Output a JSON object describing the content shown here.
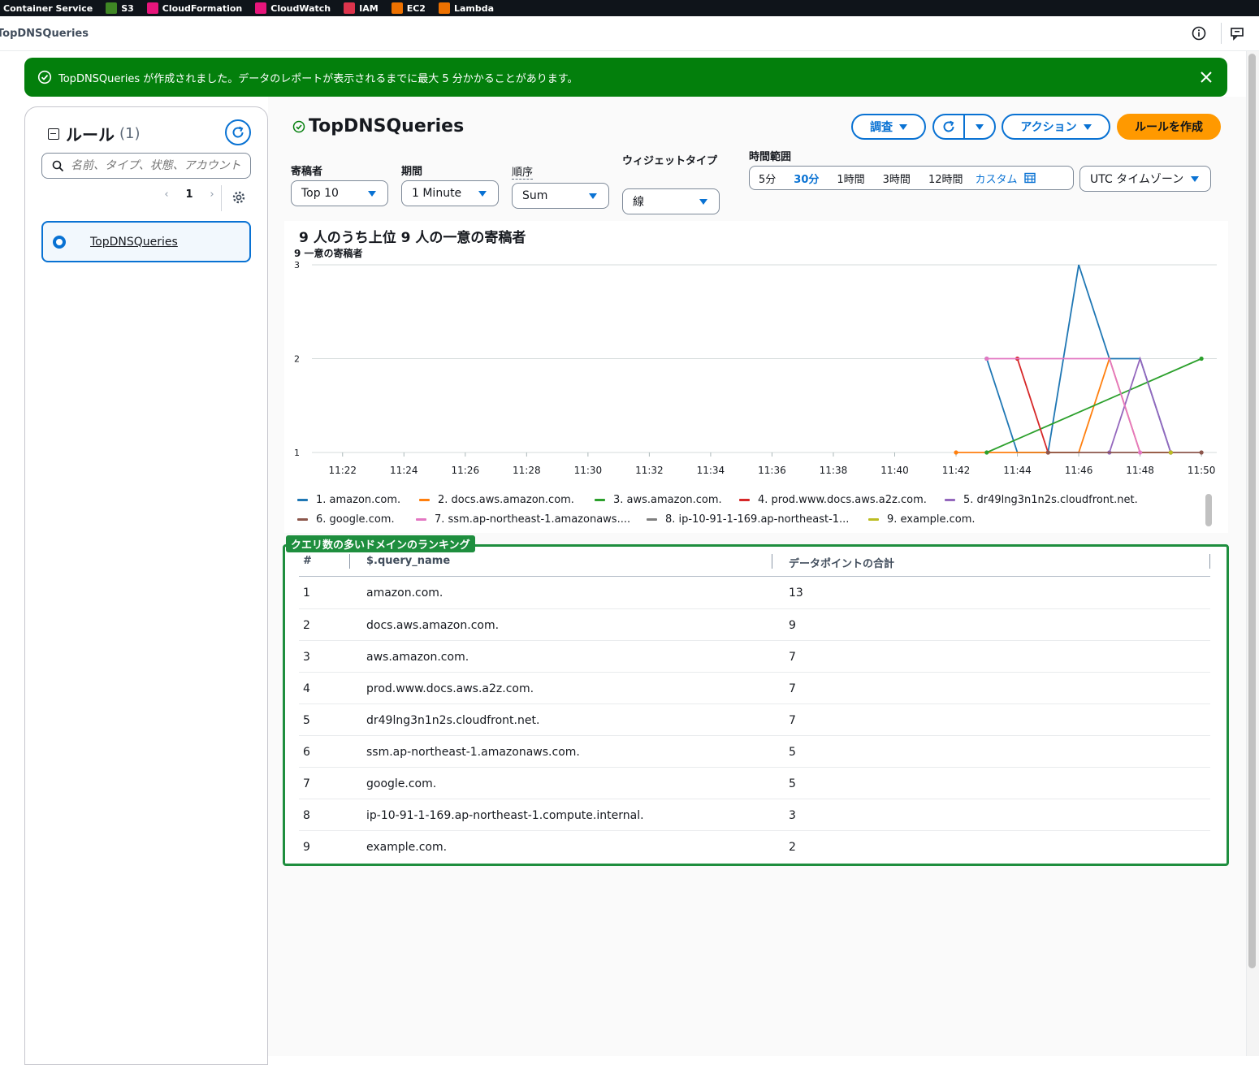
{
  "topnav": {
    "services": [
      {
        "label": "Container Service",
        "color": ""
      },
      {
        "label": "S3",
        "color": "#3f8624"
      },
      {
        "label": "CloudFormation",
        "color": "#e7157b"
      },
      {
        "label": "CloudWatch",
        "color": "#e7157b"
      },
      {
        "label": "IAM",
        "color": "#dd344c"
      },
      {
        "label": "EC2",
        "color": "#ed7100"
      },
      {
        "label": "Lambda",
        "color": "#ed7100"
      }
    ]
  },
  "header": {
    "page_title": "TopDNSQueries"
  },
  "flash": {
    "message": "TopDNSQueries が作成されました。データのレポートが表示されるまでに最大 5 分かかることがあります。",
    "color": "#037f0c"
  },
  "sidebar": {
    "title": "ルール",
    "count": "(1)",
    "search_placeholder": "名前、タイプ、状態、アカウント",
    "page": "1",
    "rules": [
      {
        "name": "TopDNSQueries",
        "selected": true
      }
    ]
  },
  "widget": {
    "title": "TopDNSQueries",
    "buttons": {
      "investigate": "調査",
      "actions": "アクション",
      "create_rule": "ルールを作成"
    },
    "filters": {
      "contributor_label": "寄稿者",
      "contributor_value": "Top 10",
      "period_label": "期間",
      "period_value": "1 Minute",
      "order_label": "順序",
      "order_value": "Sum",
      "widget_type_label": "ウィジェットタイプ",
      "widget_type_value": "線",
      "time_range_label": "時間範囲",
      "time_options": [
        "5分",
        "30分",
        "1時間",
        "3時間",
        "12時間"
      ],
      "time_selected": "30分",
      "custom": "カスタム",
      "timezone": "UTC タイムゾーン"
    }
  },
  "chart_data": {
    "type": "line",
    "title": "9 人のうち上位 9 人の一意の寄稿者",
    "ylabel": "9 一意の寄稿者",
    "xlabel": "",
    "x_ticks": [
      "11:22",
      "11:24",
      "11:26",
      "11:28",
      "11:30",
      "11:32",
      "11:34",
      "11:36",
      "11:38",
      "11:40",
      "11:42",
      "11:44",
      "11:46",
      "11:48",
      "11:50"
    ],
    "y_ticks": [
      1,
      2,
      3
    ],
    "ylim": [
      1,
      3
    ],
    "x_range_minutes": [
      21,
      50.5
    ],
    "grid": true,
    "legend_position": "bottom",
    "series": [
      {
        "name": "1. amazon.com.",
        "color": "#1f77b4",
        "points": [
          [
            "11:43",
            2
          ],
          [
            "11:44",
            1
          ],
          [
            "11:45",
            1
          ],
          [
            "11:46",
            3
          ],
          [
            "11:47",
            2
          ],
          [
            "11:48",
            2
          ],
          [
            "11:49",
            1
          ]
        ]
      },
      {
        "name": "2. docs.aws.amazon.com.",
        "color": "#ff7f0e",
        "points": [
          [
            "11:42",
            1
          ],
          [
            "11:43",
            1
          ],
          [
            "11:44",
            1
          ],
          [
            "11:45",
            1
          ],
          [
            "11:46",
            1
          ],
          [
            "11:47",
            2
          ],
          [
            "11:48",
            1
          ],
          [
            "11:49",
            1
          ]
        ]
      },
      {
        "name": "3. aws.amazon.com.",
        "color": "#2ca02c",
        "points": [
          [
            "11:43",
            1
          ],
          [
            "11:50",
            2
          ]
        ]
      },
      {
        "name": "4. prod.www.docs.aws.a2z.com.",
        "color": "#d62728",
        "points": [
          [
            "11:44",
            2
          ],
          [
            "11:45",
            1
          ]
        ]
      },
      {
        "name": "5. dr49lng3n1n2s.cloudfront.net.",
        "color": "#9467bd",
        "points": [
          [
            "11:47",
            1
          ],
          [
            "11:48",
            2
          ],
          [
            "11:49",
            1
          ]
        ]
      },
      {
        "name": "6. google.com.",
        "color": "#8c564b",
        "points": [
          [
            "11:45",
            1
          ],
          [
            "11:49",
            1
          ],
          [
            "11:50",
            1
          ]
        ]
      },
      {
        "name": "7. ssm.ap-northeast-1.amazonaws.com.",
        "label": "7. ssm.ap-northeast-1.amazonaws....",
        "color": "#e377c2",
        "points": [
          [
            "11:43",
            2
          ],
          [
            "11:47",
            2
          ],
          [
            "11:48",
            1
          ]
        ]
      },
      {
        "name": "8. ip-10-91-1-169.ap-northeast-1.compute.internal.",
        "label": "8. ip-10-91-1-169.ap-northeast-1...",
        "color": "#7f7f7f",
        "points": []
      },
      {
        "name": "9. example.com.",
        "color": "#bcbd22",
        "points": [
          [
            "11:49",
            1
          ]
        ]
      }
    ]
  },
  "table": {
    "badge": "クエリ数の多いドメインのランキング",
    "columns": [
      "#",
      "$.query_name",
      "データポイントの合計"
    ],
    "rows": [
      [
        "1",
        "amazon.com.",
        "13"
      ],
      [
        "2",
        "docs.aws.amazon.com.",
        "9"
      ],
      [
        "3",
        "aws.amazon.com.",
        "7"
      ],
      [
        "4",
        "prod.www.docs.aws.a2z.com.",
        "7"
      ],
      [
        "5",
        "dr49lng3n1n2s.cloudfront.net.",
        "7"
      ],
      [
        "6",
        "ssm.ap-northeast-1.amazonaws.com.",
        "5"
      ],
      [
        "7",
        "google.com.",
        "5"
      ],
      [
        "8",
        "ip-10-91-1-169.ap-northeast-1.compute.internal.",
        "3"
      ],
      [
        "9",
        "example.com.",
        "2"
      ]
    ]
  }
}
